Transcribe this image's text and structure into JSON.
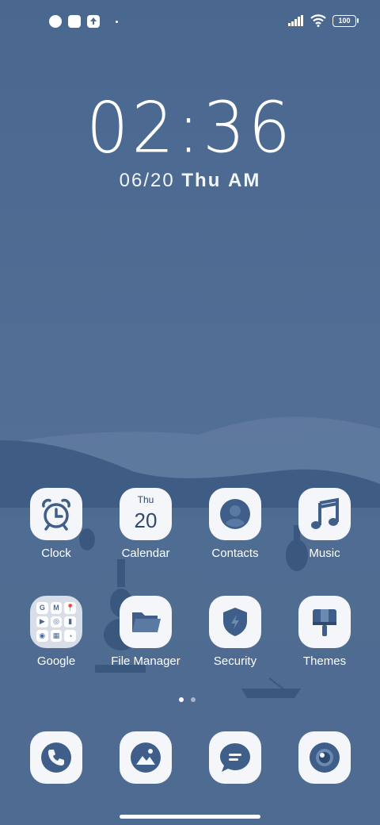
{
  "status_bar": {
    "battery": "100"
  },
  "lockclock": {
    "time": "02:36",
    "date": "06/20",
    "day": "Thu",
    "ampm": "AM"
  },
  "apps": [
    {
      "label": "Clock",
      "icon": "alarm-clock-icon"
    },
    {
      "label": "Calendar",
      "icon": "calendar-icon",
      "day": "Thu",
      "date": "20"
    },
    {
      "label": "Contacts",
      "icon": "person-icon"
    },
    {
      "label": "Music",
      "icon": "music-note-icon"
    },
    {
      "label": "Google",
      "icon": "folder-icon",
      "folder_items": [
        "G",
        "M",
        "📍",
        "▶",
        "◎",
        "▮",
        "◉",
        "▦",
        "◔"
      ]
    },
    {
      "label": "File Manager",
      "icon": "folder-open-icon"
    },
    {
      "label": "Security",
      "icon": "shield-icon"
    },
    {
      "label": "Themes",
      "icon": "brush-icon"
    }
  ],
  "dock": [
    {
      "icon": "phone-icon"
    },
    {
      "icon": "gallery-icon"
    },
    {
      "icon": "message-icon"
    },
    {
      "icon": "camera-icon"
    }
  ],
  "pager": {
    "pages": 2,
    "active": 1
  },
  "colors": {
    "accent": "#3f5f8a",
    "icon_bg": "#f5f6f9",
    "wallpaper": "#4d6a90"
  }
}
